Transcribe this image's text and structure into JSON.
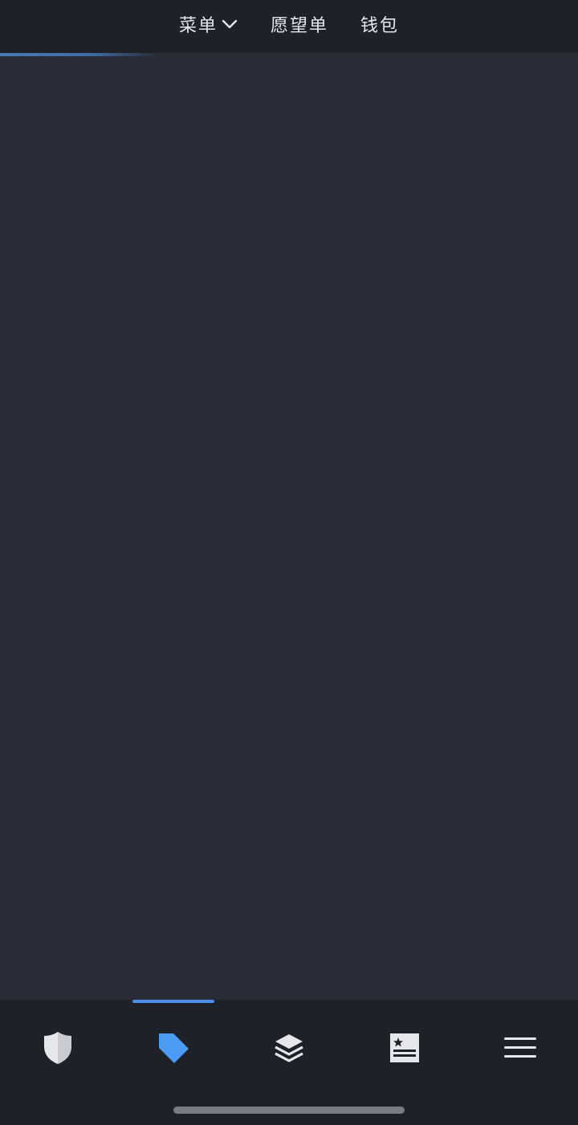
{
  "header": {
    "menu_label": "菜单",
    "wishlist_label": "愿望单",
    "wallet_label": "钱包"
  },
  "loading": {
    "progress_fraction": 0.27
  },
  "bottom_tabs": [
    {
      "icon": "shield-icon",
      "active": false
    },
    {
      "icon": "tag-icon",
      "active": true
    },
    {
      "icon": "layers-icon",
      "active": false
    },
    {
      "icon": "news-icon",
      "active": false
    },
    {
      "icon": "hamburger-menu-icon",
      "active": false
    }
  ],
  "colors": {
    "background": "#292c36",
    "bar_background": "#1f2128",
    "accent": "#4c8ef0",
    "icon_inactive": "#e6e7ea"
  }
}
